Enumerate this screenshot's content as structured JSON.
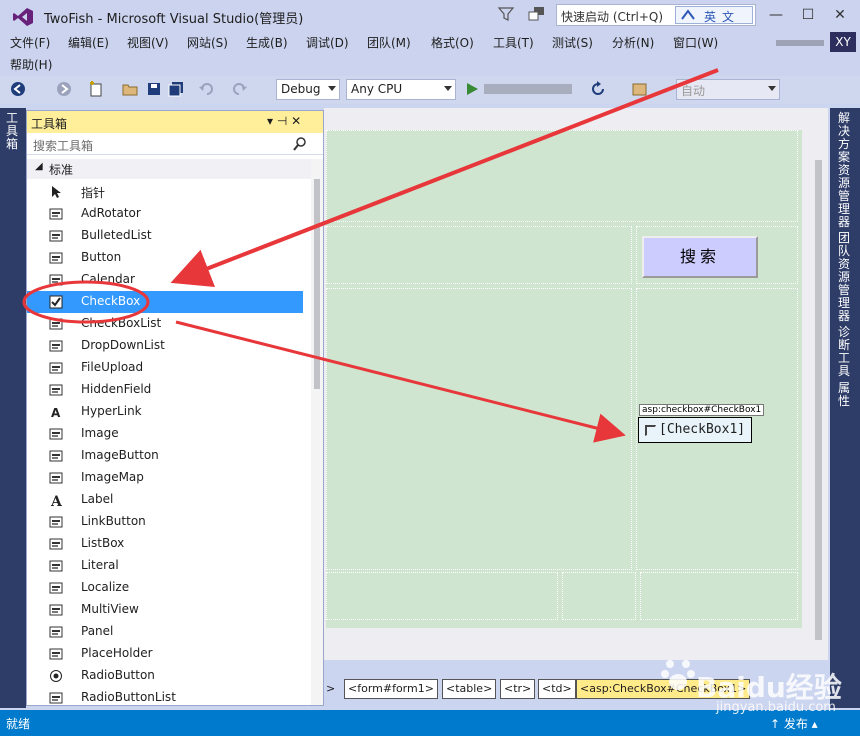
{
  "window": {
    "title": "TwoFish - Microsoft Visual Studio(管理员)",
    "quick_launch": "快速启动 (Ctrl+Q)",
    "ime_label": "英文",
    "minimize": "—",
    "maximize": "☐",
    "close": "✕"
  },
  "menu": {
    "items": [
      "文件(F)",
      "编辑(E)",
      "视图(V)",
      "网站(S)",
      "生成(B)",
      "调试(D)",
      "团队(M)",
      "格式(O)",
      "工具(T)",
      "测试(S)",
      "分析(N)",
      "窗口(W)"
    ],
    "help": "帮助(H)",
    "avatar": "XY"
  },
  "toolbar": {
    "config": "Debug",
    "platform": "Any CPU",
    "auto": "自动"
  },
  "left_tab": "工具箱",
  "toolbox": {
    "title": "工具箱",
    "pin": "▾ ⊣ ✕",
    "search_placeholder": "搜索工具箱",
    "group": "标准",
    "items": [
      {
        "label": "指针",
        "icon": "pointer-icon"
      },
      {
        "label": "AdRotator",
        "icon": "adrotator-icon"
      },
      {
        "label": "BulletedList",
        "icon": "bulletedlist-icon"
      },
      {
        "label": "Button",
        "icon": "button-icon"
      },
      {
        "label": "Calendar",
        "icon": "calendar-icon"
      },
      {
        "label": "CheckBox",
        "icon": "checkbox-icon",
        "selected": true
      },
      {
        "label": "CheckBoxList",
        "icon": "checkboxlist-icon"
      },
      {
        "label": "DropDownList",
        "icon": "dropdownlist-icon"
      },
      {
        "label": "FileUpload",
        "icon": "fileupload-icon"
      },
      {
        "label": "HiddenField",
        "icon": "hiddenfield-icon"
      },
      {
        "label": "HyperLink",
        "icon": "hyperlink-icon"
      },
      {
        "label": "Image",
        "icon": "image-icon"
      },
      {
        "label": "ImageButton",
        "icon": "imagebutton-icon"
      },
      {
        "label": "ImageMap",
        "icon": "imagemap-icon"
      },
      {
        "label": "Label",
        "icon": "label-icon"
      },
      {
        "label": "LinkButton",
        "icon": "linkbutton-icon"
      },
      {
        "label": "ListBox",
        "icon": "listbox-icon"
      },
      {
        "label": "Literal",
        "icon": "literal-icon"
      },
      {
        "label": "Localize",
        "icon": "localize-icon"
      },
      {
        "label": "MultiView",
        "icon": "multiview-icon"
      },
      {
        "label": "Panel",
        "icon": "panel-icon"
      },
      {
        "label": "PlaceHolder",
        "icon": "placeholder-icon"
      },
      {
        "label": "RadioButton",
        "icon": "radiobutton-icon"
      },
      {
        "label": "RadioButtonList",
        "icon": "radiobuttonlist-icon"
      }
    ]
  },
  "designer": {
    "search_button": "搜索",
    "checkbox_tag": "asp:checkbox#CheckBox1",
    "checkbox_label": "[CheckBox1]"
  },
  "breadcrumbs": [
    "<form#form1>",
    "<table>",
    "<tr>",
    "<td>",
    "<asp:CheckBox#CheckBox1>"
  ],
  "right_tabs": [
    "解决方案资源管理器",
    "团队资源管理器",
    "诊断工具",
    "属性"
  ],
  "status": {
    "text": "就绪",
    "publish": "↑ 发布 ▴"
  },
  "watermark": {
    "text": "Baidu经验",
    "sub": "jingyan.baidu.com"
  },
  "colors": {
    "accent": "#007acc",
    "selection": "#3399ff",
    "annotation": "#e8373a",
    "design_surface": "#cfe5cf"
  }
}
